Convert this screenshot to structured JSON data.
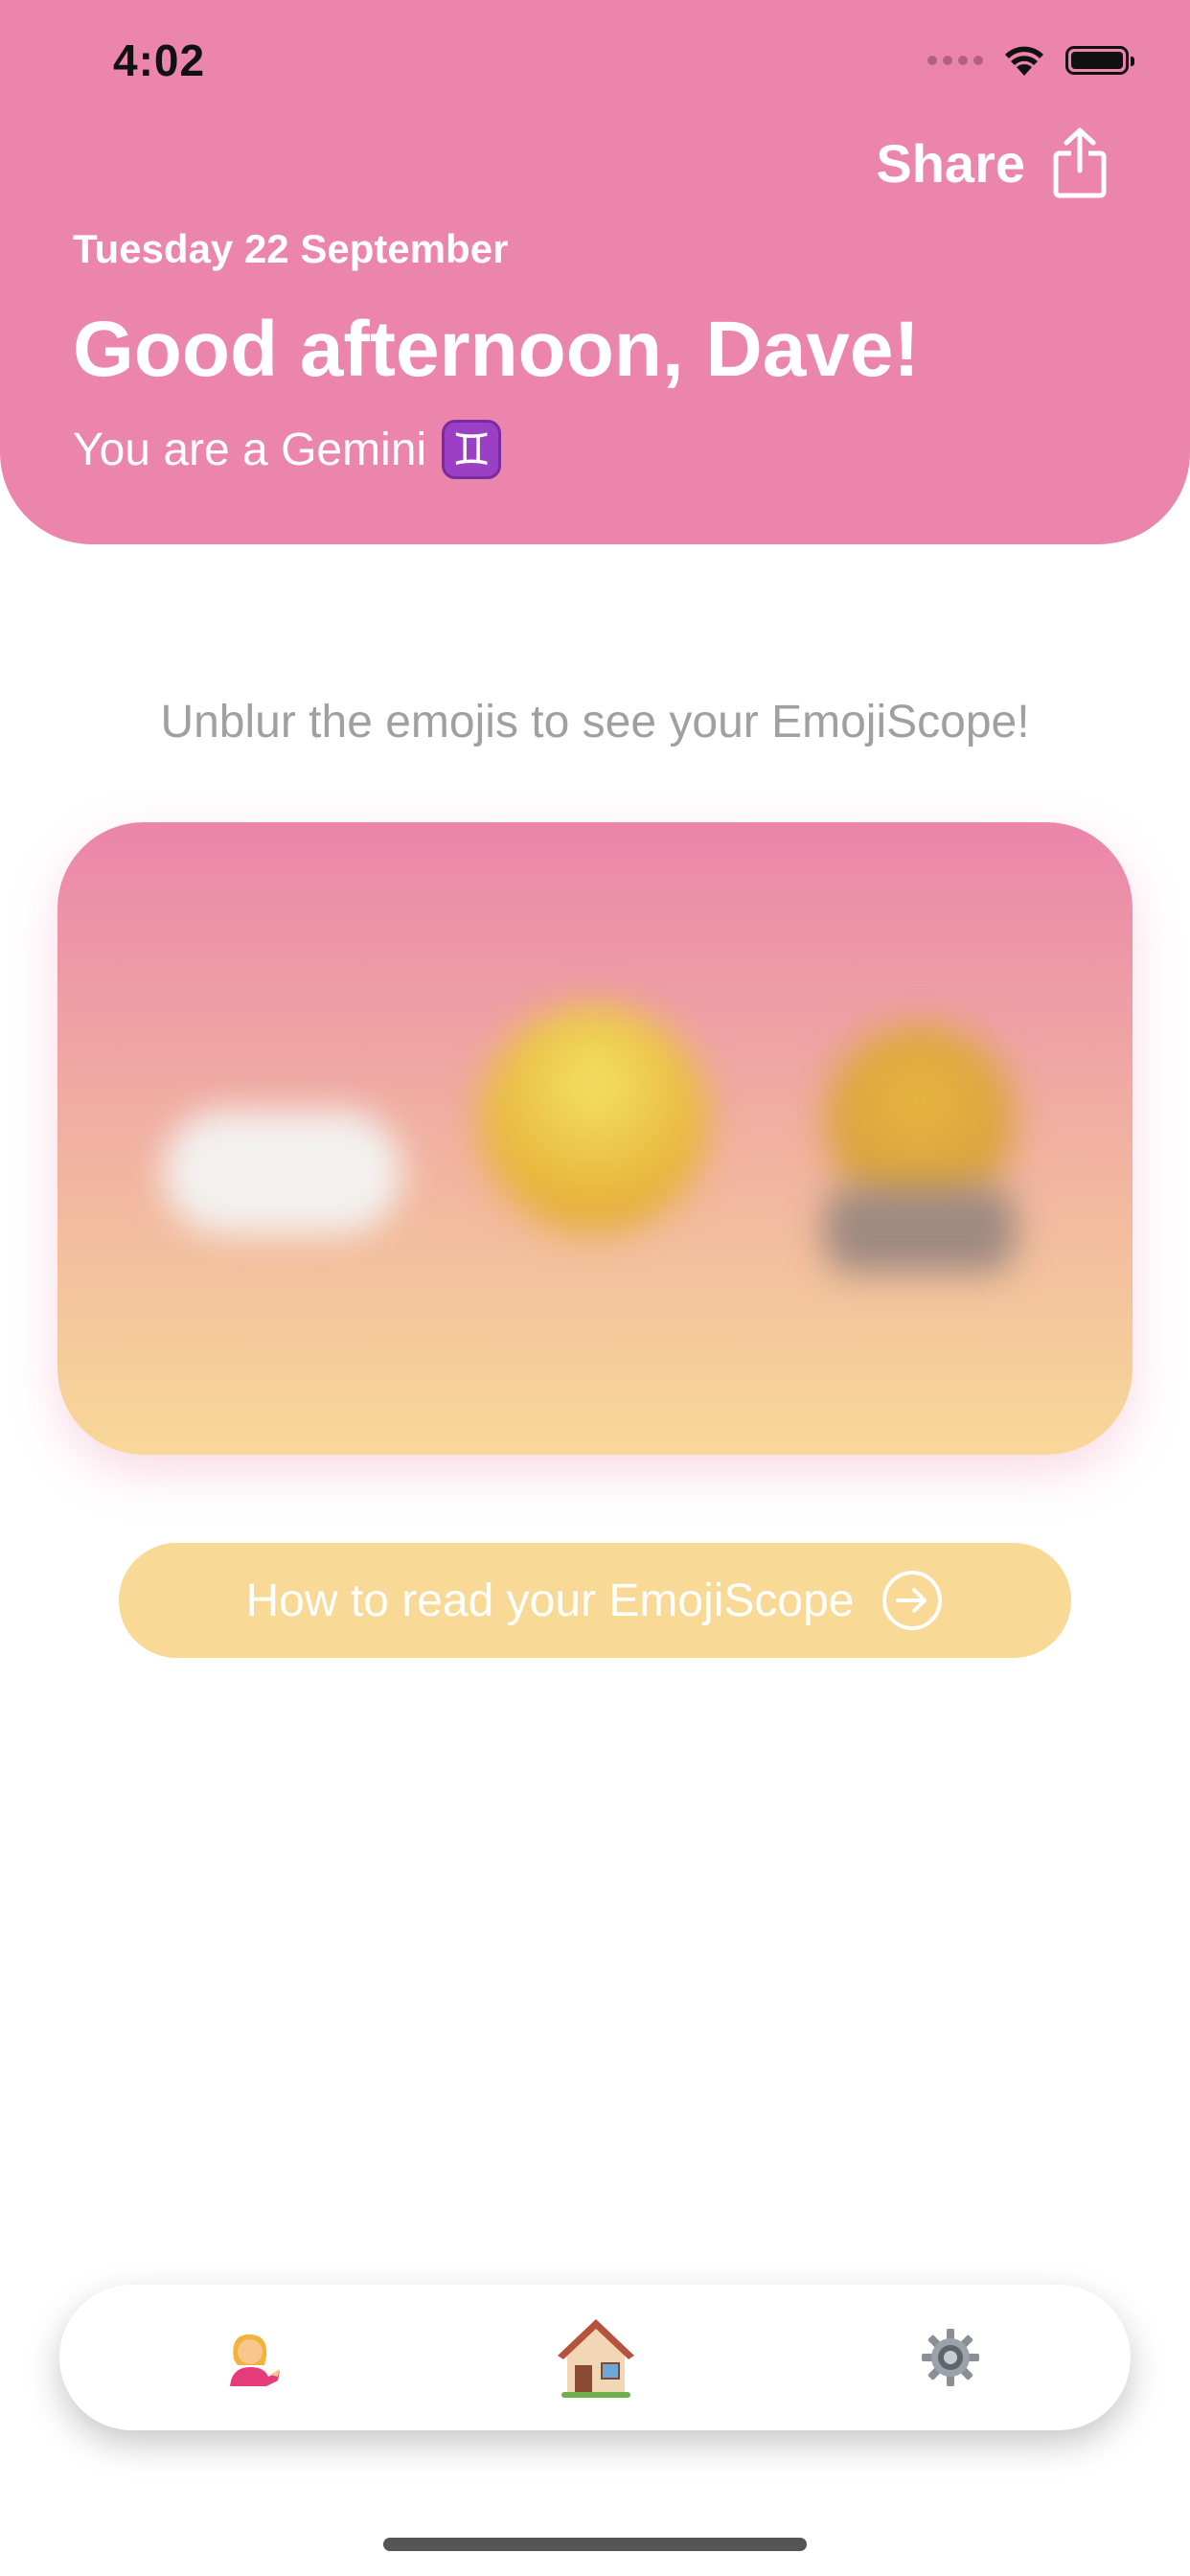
{
  "status_bar": {
    "time": "4:02"
  },
  "header": {
    "share_label": "Share",
    "date": "Tuesday 22 September",
    "greeting": "Good afternoon, Dave!",
    "sign_text": "You are a Gemini",
    "sign_symbol": "♊",
    "background_color": "#EB85AB"
  },
  "main": {
    "instruction": "Unblur the emojis to see your EmojiScope!",
    "blurred_emojis": [
      "cloud",
      "sun-face",
      "person"
    ],
    "how_to_label": "How to read your EmojiScope",
    "how_to_icon": "arrow-circle-right-icon",
    "accent_color": "#F8DA96"
  },
  "tab_bar": {
    "items": [
      {
        "name": "profile",
        "icon": "person-tipping-hand-icon"
      },
      {
        "name": "home",
        "icon": "house-icon"
      },
      {
        "name": "settings",
        "icon": "gear-icon"
      }
    ]
  }
}
